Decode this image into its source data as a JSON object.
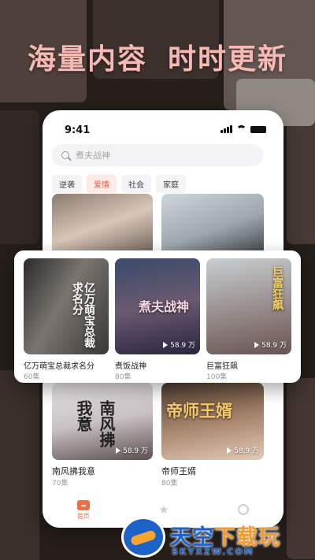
{
  "headline": {
    "left": "海量内容",
    "right": "时时更新"
  },
  "status": {
    "time": "9:41"
  },
  "search": {
    "placeholder": "煮夫战神"
  },
  "tags": [
    "逆袭",
    "爱情",
    "社会",
    "家庭"
  ],
  "active_tag": "爱情",
  "grid": [
    {
      "title": "南风拂我意",
      "episodes": "70集",
      "views": "58.9 万",
      "poster_text": "南风拂我意"
    },
    {
      "title": "帝师王婿",
      "episodes": "80集",
      "views": "58.9 万",
      "poster_text": "帝师王婿"
    }
  ],
  "popup": [
    {
      "title": "亿万萌宝总裁求名分",
      "episodes": "60集",
      "views": "",
      "poster_text": "亿万萌宝总裁求名分"
    },
    {
      "title": "煮饭战神",
      "episodes": "80集",
      "views": "58.9 万",
      "poster_text": "煮夫战神"
    },
    {
      "title": "巨富狂飙",
      "episodes": "100集",
      "views": "58.9 万",
      "poster_text": "巨富狂飙"
    }
  ],
  "tabbar": {
    "home": "首页",
    "tab2": "",
    "tab3": ""
  },
  "watermark": {
    "title_blue": "天空",
    "title_orange": "下载玩",
    "sub": "SKYXZW.COM"
  },
  "colors": {
    "accent": "#e65c43",
    "headline": "#f6b9b4",
    "tab_active": "#f0703d"
  }
}
